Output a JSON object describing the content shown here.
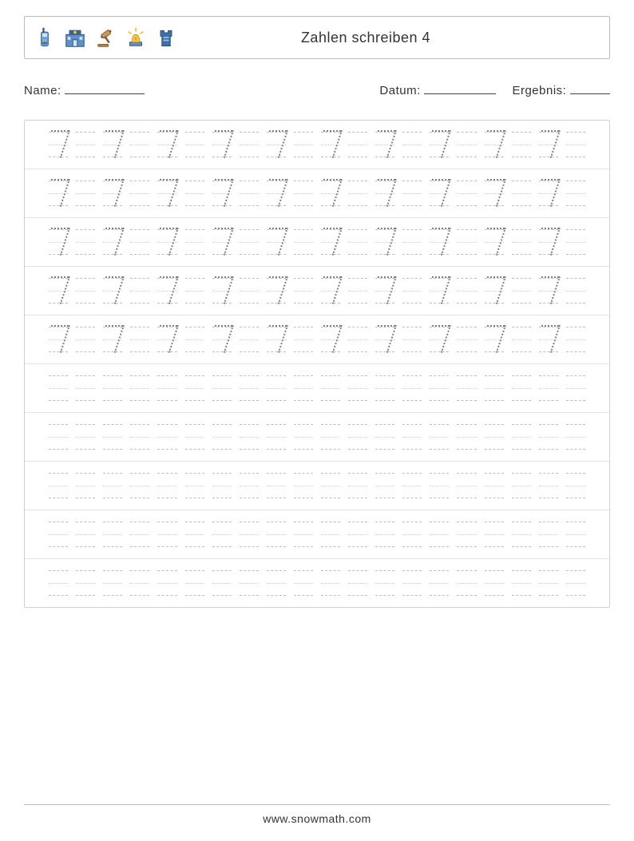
{
  "header": {
    "title": "Zahlen schreiben 4",
    "icons": [
      "walkie-talkie-icon",
      "police-station-icon",
      "gavel-icon",
      "siren-icon",
      "body-armor-icon"
    ]
  },
  "meta": {
    "name_label": "Name:",
    "date_label": "Datum:",
    "result_label": "Ergebnis:"
  },
  "worksheet": {
    "traced_digit": "7",
    "rows": 10,
    "cells_per_row": 20,
    "filled_rows": 5,
    "digit_pattern": "alternating"
  },
  "footer": {
    "site": "www.snowmath.com"
  },
  "colors": {
    "border": "#bbbbbb",
    "guide": "#cfcfcf",
    "digit_dot": "#808080"
  }
}
